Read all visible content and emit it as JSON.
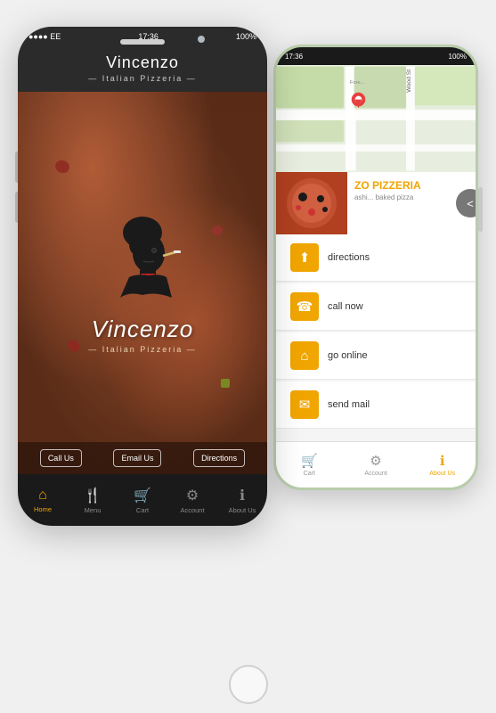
{
  "page": {
    "bg_color": "#f0f0f0"
  },
  "phone_white": {
    "status": {
      "signals": "●●●● EE",
      "time": "17:36",
      "battery": "100%"
    },
    "header": {
      "title": "Vincenzo",
      "subtitle": "— Italian Pizzeria —"
    },
    "brand": {
      "name": "Vincenzo",
      "tagline": "— Italian Pizzeria —"
    },
    "buttons": {
      "call": "Call Us",
      "email": "Email Us",
      "directions": "Directions"
    },
    "nav": [
      {
        "id": "home",
        "label": "Home",
        "icon": "⌂",
        "active": true
      },
      {
        "id": "menu",
        "label": "Menu",
        "icon": "🍴",
        "active": false
      },
      {
        "id": "cart",
        "label": "Cart",
        "icon": "🛒",
        "active": false
      },
      {
        "id": "account",
        "label": "Account",
        "icon": "⚙",
        "active": false
      },
      {
        "id": "about",
        "label": "About Us",
        "icon": "ℹ",
        "active": false
      }
    ]
  },
  "phone_green": {
    "status": {
      "time": "17:36",
      "battery": "100%"
    },
    "restaurant": {
      "name": "ZO PIZZERIA",
      "address": "ashi... baked pizza"
    },
    "actions": [
      {
        "id": "directions",
        "label": "directions",
        "icon": "⬆"
      },
      {
        "id": "call",
        "label": "call now",
        "icon": "📞"
      },
      {
        "id": "online",
        "label": "go online",
        "icon": "⌂"
      },
      {
        "id": "mail",
        "label": "send mail",
        "icon": "✉"
      }
    ],
    "nav": [
      {
        "id": "cart",
        "label": "Cart",
        "icon": "🛒",
        "active": false
      },
      {
        "id": "account",
        "label": "Account",
        "icon": "⚙",
        "active": false
      },
      {
        "id": "about",
        "label": "About Us",
        "icon": "ℹ",
        "active": true
      }
    ]
  }
}
